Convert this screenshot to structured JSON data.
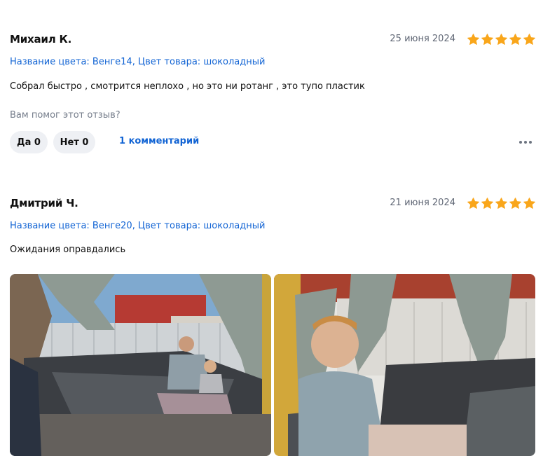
{
  "reviews": [
    {
      "author": "Михаил К.",
      "date": "25 июня 2024",
      "rating": 5,
      "variant": "Название цвета: Венге14, Цвет товара: шоколадный",
      "text": "Собрал быстро , смотрится неплохо , но это ни ротанг , это тупо пластик",
      "helpful_question": "Вам помог этот отзыв?",
      "yes_label": "Да 0",
      "no_label": "Нет 0",
      "comments_label": "1 комментарий"
    },
    {
      "author": "Дмитрий Ч.",
      "date": "21 июня 2024",
      "rating": 5,
      "variant": "Название цвета: Венге20, Цвет товара: шоколадный",
      "text": "Ожидания оправдались",
      "photos": [
        "review-photo-1",
        "review-photo-2"
      ]
    }
  ],
  "colors": {
    "star": "#f9a61b",
    "link": "#1264d4",
    "button_bg": "#eef0f4"
  },
  "icons": [
    "star-icon",
    "more-icon"
  ]
}
